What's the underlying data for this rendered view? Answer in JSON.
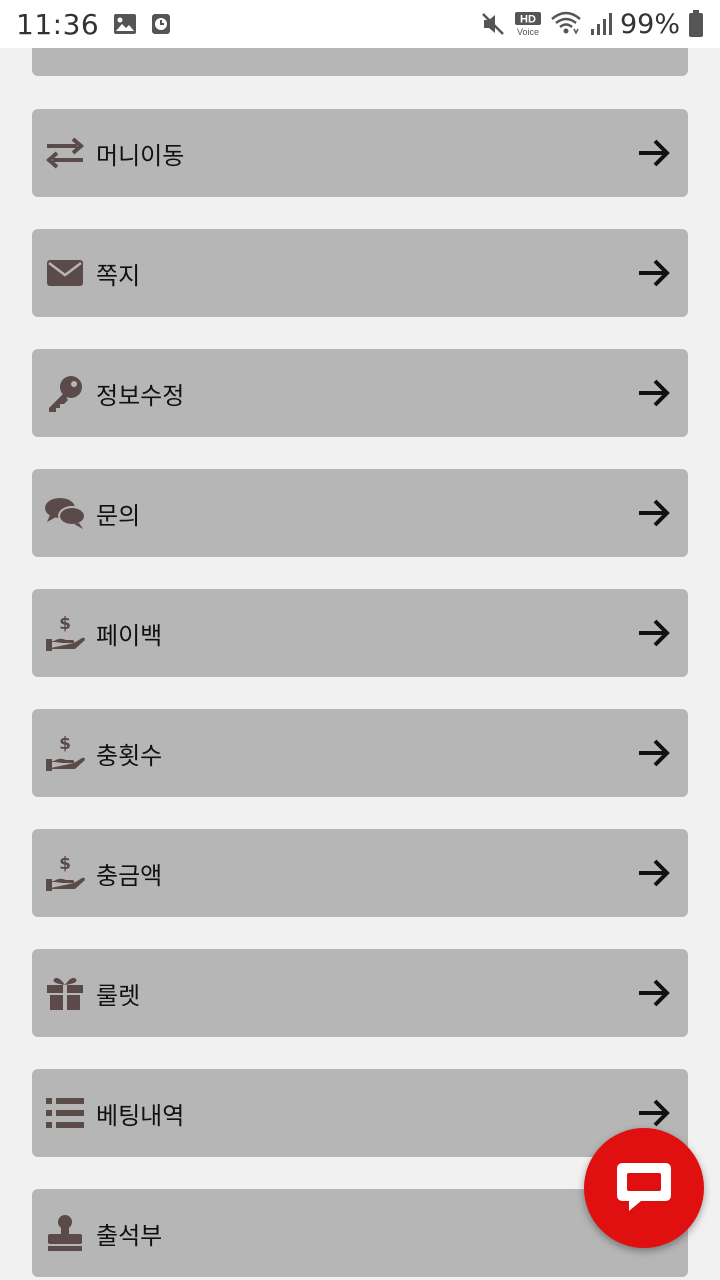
{
  "status_bar": {
    "time": "11:36",
    "battery_percent": "99%",
    "hd_label": "HD",
    "voice_label": "Voice"
  },
  "menu": {
    "items": [
      {
        "label": "",
        "icon": "unknown-icon"
      },
      {
        "label": "머니이동",
        "icon": "exchange-arrows-icon"
      },
      {
        "label": "쪽지",
        "icon": "envelope-icon"
      },
      {
        "label": "정보수정",
        "icon": "key-icon"
      },
      {
        "label": "문의",
        "icon": "chat-bubbles-icon"
      },
      {
        "label": "페이백",
        "icon": "hand-holding-dollar-icon"
      },
      {
        "label": "충횟수",
        "icon": "hand-holding-dollar-icon"
      },
      {
        "label": "충금액",
        "icon": "hand-holding-dollar-icon"
      },
      {
        "label": "룰렛",
        "icon": "gift-icon"
      },
      {
        "label": "베팅내역",
        "icon": "list-icon"
      },
      {
        "label": "출석부",
        "icon": "stamp-icon"
      }
    ]
  },
  "colors": {
    "item_background": "#b6b6b6",
    "icon_color": "#5a4a4a",
    "fab_red": "#e01010",
    "page_background": "#f1f1f1"
  }
}
